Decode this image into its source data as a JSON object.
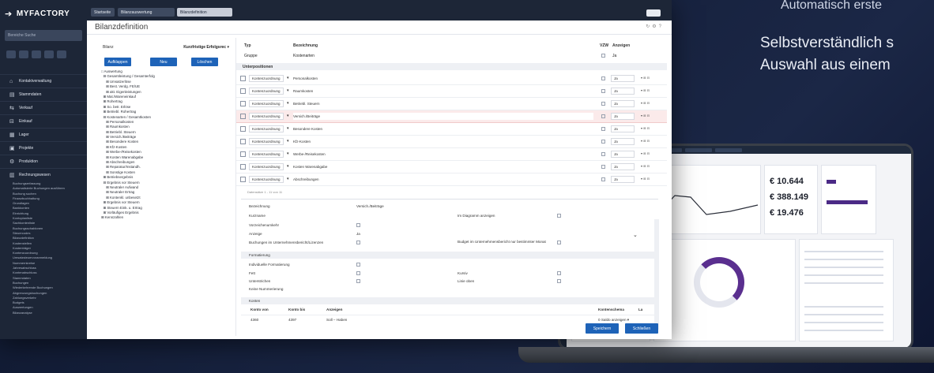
{
  "side": {
    "line1": "Automatisch erste",
    "line2": "Selbstverständlich s",
    "line3": "Auswahl aus einem"
  },
  "app": {
    "logo": "MYFACTORY",
    "search_placeholder": "Bereiche Suche",
    "tabs": [
      "Startseite",
      "Bilanzauswertung",
      "Bilanzdefinition"
    ],
    "page_title": "Bilanzdefinition",
    "nav": [
      {
        "icon": "⌂",
        "label": "Kontaktverwaltung"
      },
      {
        "icon": "▤",
        "label": "Stammdaten"
      },
      {
        "icon": "⇆",
        "label": "Verkauf"
      },
      {
        "icon": "⊟",
        "label": "Einkauf"
      },
      {
        "icon": "▦",
        "label": "Lager"
      },
      {
        "icon": "▣",
        "label": "Projekte"
      },
      {
        "icon": "⚙",
        "label": "Produktion"
      },
      {
        "icon": "▥",
        "label": "Rechnungswesen"
      }
    ],
    "dark_tree": [
      "Buchungserfassung",
      "Automatisierte Buchungen ausführen",
      "Buchung suchen",
      "Finanzbuchhaltung",
      "Grundlagen",
      "Bankkonten",
      "Einrichtung",
      "Kontoplanliste",
      "Sachkontenliste",
      "Buchungsschablonen",
      "Steuercodes",
      "Bilanzdefinition",
      "Kostenstellen",
      "Kostenträger",
      "Kontenzuordnung",
      "Umsatzsteuervoranmeldung",
      "Nummernkreise",
      "Jahresabschluss",
      "Kontenabschluss",
      "Stammdaten",
      "Buchungen",
      "Wiederkehrende Buchungen",
      "Abgrenzungsbuchungen",
      "Zahlungsverkehr",
      "Budgets",
      "Auswertungen",
      "Bilanzanalyse"
    ]
  },
  "tree_panel": {
    "label": "Bilanz",
    "select_value": "Kurzfristige Erfolgsrec ▾",
    "buttons": [
      "Aufklappen",
      "Neu",
      "Löschen"
    ],
    "items": [
      "□ Auswertung",
      "  ⊟ Gesamtleistung / Gesamterfolg",
      "     ⊞ Umsatzerlöse",
      "     ⊞ Best. Verdg. FE/UE",
      "     ⊞ akt. Eigenleistungen",
      "  ⊞ Mat./Wareneinkauf",
      "  ⊞ Rohertrag",
      "  ⊞ So. betr. Erlöse",
      "  ⊞ Betriebl. Rohertrag",
      "  ⊟ Kostenarten / Gesamtkosten",
      "     ⊞ Personalkosten",
      "     ⊞ Raumkosten",
      "     ⊞ Betriebl. Steuern",
      "     ⊞ Versich./Beiträge",
      "     ⊞ Besondere Kosten",
      "     ⊞ Kfz-Kosten",
      "     ⊞ Werbe-/Reisekosten",
      "     ⊞ Kosten Warenabgabe",
      "     ⊞ Abschreibungen",
      "     ⊞ Reparatur/Instandh.",
      "     ⊞ Sonstige Kosten",
      "  ⊞ Betriebsergebnis",
      "  ⊟ Ergebnis vor Steuern",
      "     ⊞ Neutraler Aufwand",
      "     ⊞ Neutraler Ertrag",
      "     ⊞ Kontenkl. unbesetzt",
      "  ⊞ Ergebnis vor Steuern",
      "  ⊞ Steuern Eink. u. Ertrag",
      "  ⊞ Vorläufiges Ergebnis",
      "⊞ Kennzahlen"
    ]
  },
  "grid": {
    "headers": {
      "typ": "Typ",
      "bezeichnung": "Bezeichnung",
      "vzw": "VZW",
      "anzeigen": "Anzeigen"
    },
    "group": {
      "typ": "Gruppe",
      "name": "Kostenarten",
      "anzeigen": "Ja"
    },
    "section": "Unterpositionen",
    "rows": [
      {
        "typ": "Kontenzuordnung",
        "name": "Personalkosten",
        "anzeigen": "Ja",
        "highlight": false
      },
      {
        "typ": "Kontenzuordnung",
        "name": "Raumkosten",
        "anzeigen": "Ja",
        "highlight": false
      },
      {
        "typ": "Kontenzuordnung",
        "name": "Betriebl. Steuern",
        "anzeigen": "Ja",
        "highlight": false
      },
      {
        "typ": "Kontenzuordnung",
        "name": "Versich./Beiträge",
        "anzeigen": "Ja",
        "highlight": true
      },
      {
        "typ": "Kontenzuordnung",
        "name": "Besondere Kosten",
        "anzeigen": "Ja",
        "highlight": false
      },
      {
        "typ": "Kontenzuordnung",
        "name": "Kfz-Kosten",
        "anzeigen": "Ja",
        "highlight": false
      },
      {
        "typ": "Kontenzuordnung",
        "name": "Werbe-/Reisekosten",
        "anzeigen": "Ja",
        "highlight": false
      },
      {
        "typ": "Kontenzuordnung",
        "name": "Kosten Warenabgabe",
        "anzeigen": "Ja",
        "highlight": false
      },
      {
        "typ": "Kontenzuordnung",
        "name": "Abschreibungen",
        "anzeigen": "Ja",
        "highlight": false
      }
    ],
    "footer": "Datensätze 1 - 11 von 11"
  },
  "detail": {
    "bezeichnung_label": "Bezeichnung",
    "bezeichnung_value": "Versich./Beiträge",
    "kurzname_label": "Kurzname",
    "vorzeichenumkehr_label": "Vorzeichenumkehr",
    "anzeige_label": "Anzeige",
    "anzeige_value": "Ja",
    "buchungen_label": "Buchungen im Unternehmensbericht/Lizenzen",
    "diagramm_label": "Im Diagramm anzeigen",
    "budget_label": "Budget im Unternehmensbericht nur bestimmter Monat",
    "formatierung_section": "Formatierung",
    "fett_label": "Fett",
    "kursiv_label": "Kursiv",
    "unterstrichen_label": "Unterstrichen",
    "linie_label": "Linie oben",
    "keine_label": "Keine Nummerierung",
    "individuell_label": "Individuelle Formatierung",
    "konten_section": "Konten",
    "konten_headers": [
      "Konto von",
      "Konto bis",
      "Anzeigen",
      "Kontenschema",
      "La"
    ],
    "konten_row": [
      "4360",
      "4397",
      "Soll – Haben"
    ],
    "konten_extra": "0 Saldo anzeigen ▾",
    "save_button": "Speichern",
    "delete_button": "Schließen"
  },
  "laptop": {
    "values": [
      "€ 10.644",
      "€ 388.149",
      "€ 19.476"
    ]
  }
}
